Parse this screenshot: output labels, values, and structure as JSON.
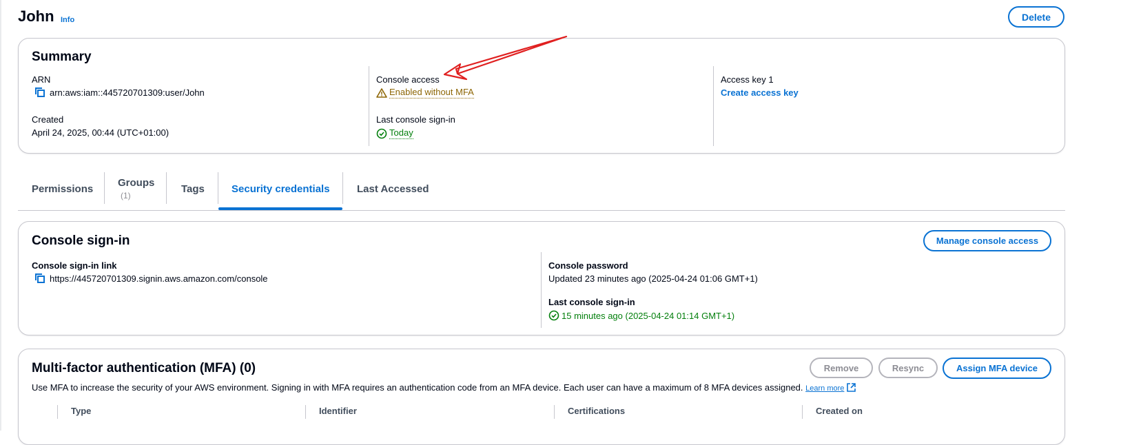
{
  "header": {
    "title": "John",
    "info_label": "Info",
    "delete_label": "Delete"
  },
  "summary": {
    "title": "Summary",
    "arn_label": "ARN",
    "arn_value": "arn:aws:iam::445720701309:user/John",
    "created_label": "Created",
    "created_value": "April 24, 2025, 00:44 (UTC+01:00)",
    "console_access_label": "Console access",
    "console_access_value": "Enabled without MFA",
    "last_signin_label": "Last console sign-in",
    "last_signin_value": "Today",
    "access_key_label": "Access key 1",
    "create_access_key_label": "Create access key"
  },
  "tabs": [
    {
      "label": "Permissions"
    },
    {
      "label": "Groups",
      "count": "(1)"
    },
    {
      "label": "Tags"
    },
    {
      "label": "Security credentials",
      "active": true
    },
    {
      "label": "Last Accessed"
    }
  ],
  "console_signin": {
    "title": "Console sign-in",
    "manage_label": "Manage console access",
    "link_label": "Console sign-in link",
    "link_value": "https://445720701309.signin.aws.amazon.com/console",
    "password_label": "Console password",
    "password_value": "Updated 23 minutes ago (2025-04-24 01:06 GMT+1)",
    "last_signin_label": "Last console sign-in",
    "last_signin_value": "15 minutes ago (2025-04-24 01:14 GMT+1)"
  },
  "mfa": {
    "title": "Multi-factor authentication (MFA) (0)",
    "remove_label": "Remove",
    "resync_label": "Resync",
    "assign_label": "Assign MFA device",
    "description": "Use MFA to increase the security of your AWS environment. Signing in with MFA requires an authentication code from an MFA device. Each user can have a maximum of 8 MFA devices assigned.",
    "learn_more": "Learn more",
    "columns": [
      "Type",
      "Identifier",
      "Certifications",
      "Created on"
    ]
  },
  "colors": {
    "link": "#0972d3",
    "warning": "#8d6605",
    "success": "#037f0c",
    "annotation_arrow": "#e02020"
  }
}
